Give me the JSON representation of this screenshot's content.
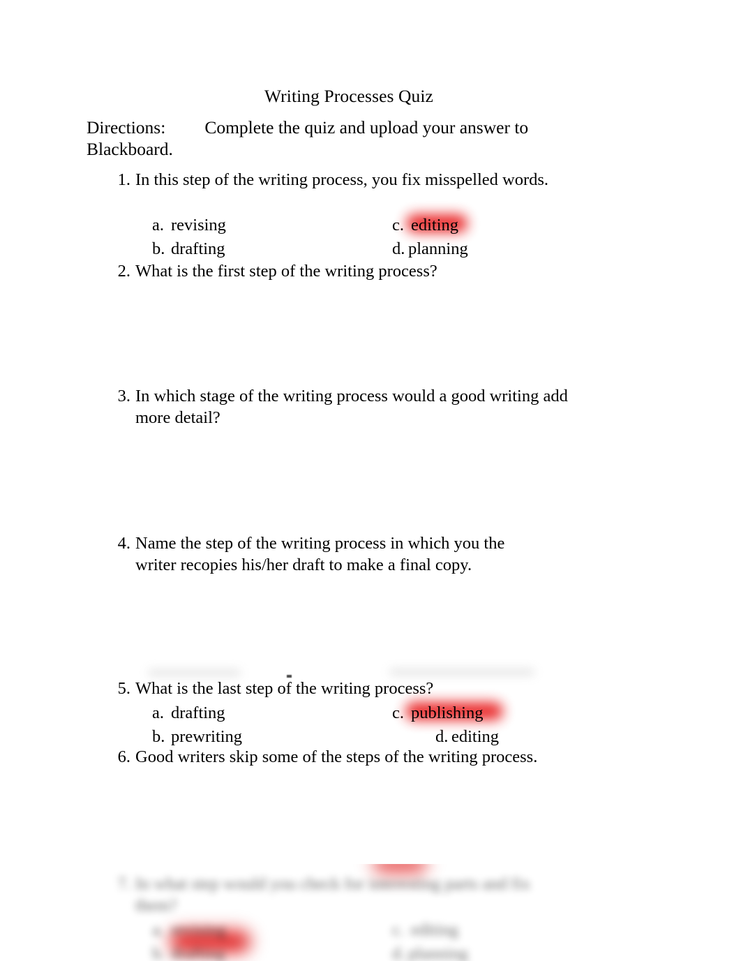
{
  "document": {
    "title": "Writing Processes Quiz",
    "directions_label": "Directions:",
    "directions_text": "Complete the quiz and upload your answer to Blackboard."
  },
  "questions": [
    {
      "number": "1.",
      "text": "In this step of the writing process, you fix misspelled words.",
      "options": [
        {
          "letter": "a.",
          "label": "revising",
          "highlighted": false
        },
        {
          "letter": "b.",
          "label": "drafting",
          "highlighted": false
        },
        {
          "letter": "c.",
          "label": "editing",
          "highlighted": true
        },
        {
          "letter": "d.",
          "label": "planning",
          "highlighted": false
        }
      ]
    },
    {
      "number": "2.",
      "text": "What is the first step of the writing process?",
      "options": []
    },
    {
      "number": "3.",
      "text": "In which stage of the writing process would a good writing add more detail?",
      "options": []
    },
    {
      "number": "4.",
      "text": "Name the step of the writing process in which you the writer recopies his/her draft to make a final copy.",
      "options": []
    },
    {
      "number": "5.",
      "text": "What is the last step of the writing process?",
      "options": [
        {
          "letter": "a.",
          "label": "drafting",
          "highlighted": false
        },
        {
          "letter": "b.",
          "label": "prewriting",
          "highlighted": false
        },
        {
          "letter": "c.",
          "label": "publishing",
          "highlighted": true
        },
        {
          "letter": "d.",
          "label": "editing",
          "highlighted": false
        }
      ]
    },
    {
      "number": "6.",
      "text": "Good writers skip some of the steps of the writing process.",
      "options": []
    },
    {
      "number": "7.",
      "text": "In what step would you check for interesting parts and fix them?",
      "options": [
        {
          "letter": "a.",
          "label": "revising",
          "highlighted": false
        },
        {
          "letter": "b.",
          "label": "drafting",
          "highlighted": true
        },
        {
          "letter": "c.",
          "label": "editing",
          "highlighted": false
        },
        {
          "letter": "d.",
          "label": "planning",
          "highlighted": false
        }
      ]
    }
  ],
  "colors": {
    "highlight_red": "#e8191a",
    "page_background": "#ffffff",
    "text": "#000000"
  }
}
